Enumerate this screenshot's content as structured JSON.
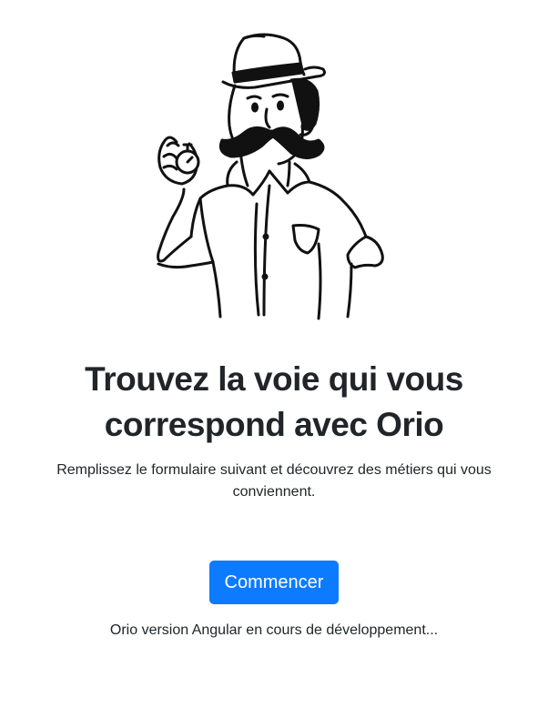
{
  "hero": {
    "illustration": "man-with-hat-mustache-holding-stopwatch",
    "title_line1": "Trouvez la voie qui vous",
    "title_line2": "correspond avec Orio",
    "subtitle": "Remplissez le formulaire suivant et découvrez des métiers qui vous conviennent.",
    "start_label": "Commencer",
    "dev_note": "Orio version Angular en cours de développement..."
  },
  "colors": {
    "accent": "#0d7bff",
    "text": "#212529",
    "background": "#ffffff"
  }
}
